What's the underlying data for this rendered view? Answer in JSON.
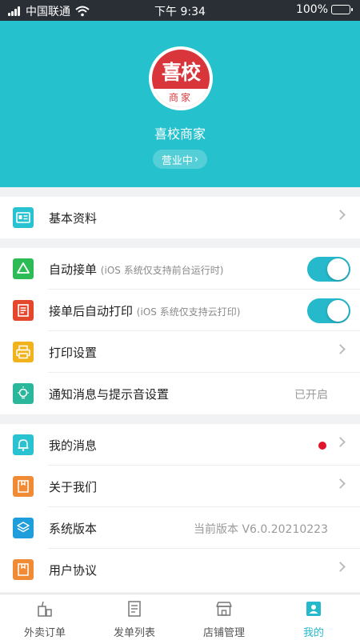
{
  "status_bar": {
    "carrier": "中国联通",
    "time": "下午 9:34",
    "battery": "100%"
  },
  "header": {
    "logo_main": "喜校",
    "logo_sub": "商家",
    "shop_name": "喜校商家",
    "status": "营业中",
    "status_arrow": "›"
  },
  "colors": {
    "header_bg": "#25c1cc",
    "accent": "#25b9cb",
    "logo_red": "#d8363b"
  },
  "section1": {
    "profile_label": "基本资料"
  },
  "section2": {
    "auto_accept_label": "自动接单",
    "auto_accept_note": "(iOS 系统仅支持前台运行时)",
    "auto_accept_on": true,
    "auto_print_label": "接单后自动打印",
    "auto_print_note": "(iOS 系统仅支持云打印)",
    "auto_print_on": true,
    "print_settings_label": "打印设置",
    "notify_label": "通知消息与提示音设置",
    "notify_value": "已开启"
  },
  "section3": {
    "messages_label": "我的消息",
    "about_label": "关于我们",
    "version_label": "系统版本",
    "version_value": "当前版本 V6.0.20210223",
    "agreement_label": "用户协议"
  },
  "tabbar": {
    "tabs": [
      {
        "label": "外卖订单",
        "icon": "takeout-cup-icon"
      },
      {
        "label": "发单列表",
        "icon": "order-list-icon"
      },
      {
        "label": "店铺管理",
        "icon": "store-icon"
      },
      {
        "label": "我的",
        "icon": "profile-card-icon"
      }
    ],
    "active_index": 3
  }
}
